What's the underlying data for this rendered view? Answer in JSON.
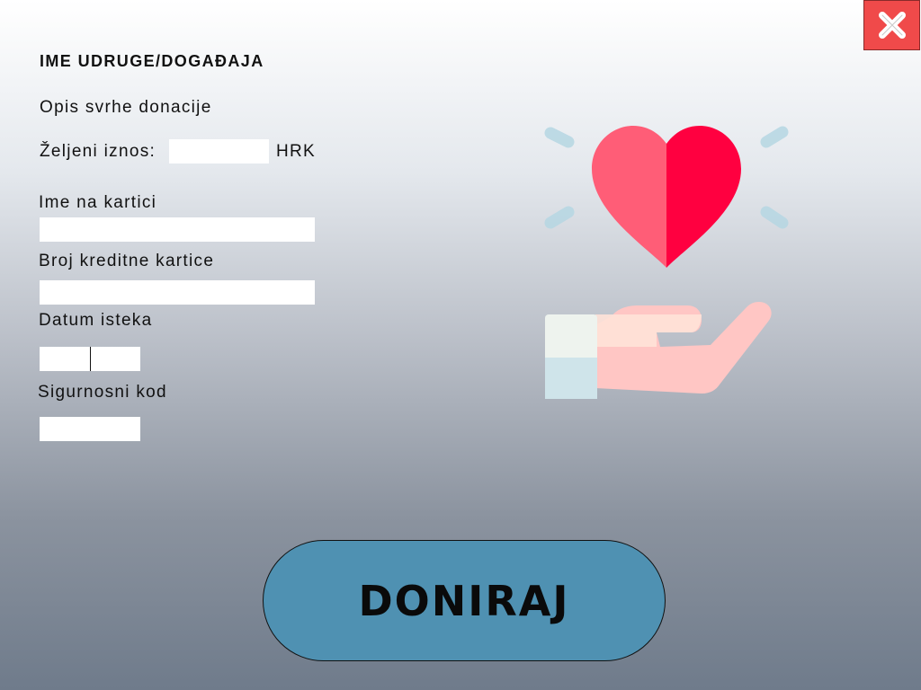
{
  "header": {
    "title": "IME UDRUGE/DOGAĐAJA",
    "description": "Opis svrhe donacije"
  },
  "amount": {
    "label": "Željeni iznos:",
    "value": "",
    "currency": "HRK"
  },
  "card_name": {
    "label": "Ime na kartici",
    "value": ""
  },
  "card_number": {
    "label": "Broj kreditne kartice",
    "value": ""
  },
  "expiry": {
    "label": "Datum isteka",
    "month_value": "",
    "year_value": ""
  },
  "security_code": {
    "label": "Sigurnosni kod",
    "value": ""
  },
  "actions": {
    "donate_label": "DONIRAJ",
    "close_icon": "close-x-icon"
  },
  "illustration": {
    "icon": "heart-in-hand-icon"
  },
  "colors": {
    "close_button": "#f04a4a",
    "donate_button": "#4f91b2",
    "heart_left": "#ff5d77",
    "heart_right": "#ff0040"
  }
}
